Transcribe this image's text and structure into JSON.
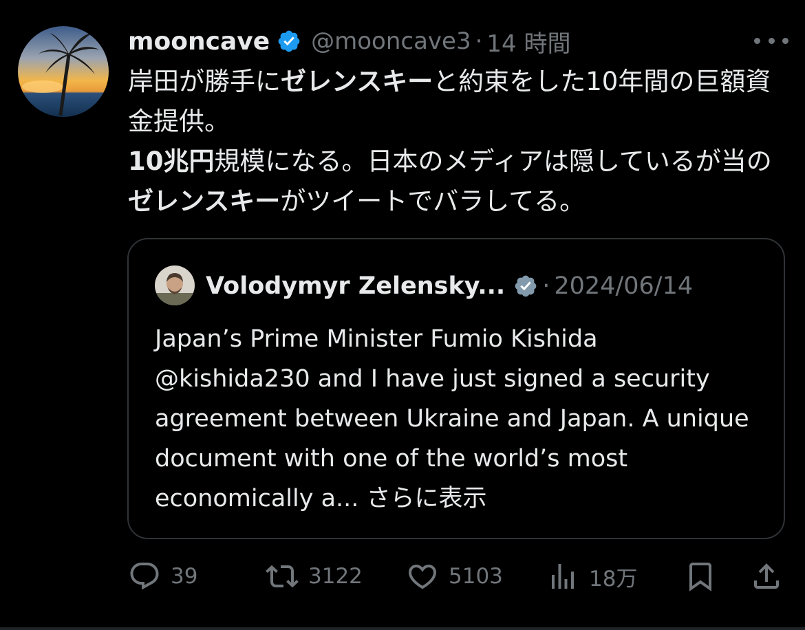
{
  "tweet": {
    "author_name": "mooncave",
    "handle": "@mooncave3",
    "separator": "·",
    "time": "14 時間",
    "text_parts": [
      {
        "text": "岸田が勝手に",
        "bold": false
      },
      {
        "text": "ゼレンスキー",
        "bold": true
      },
      {
        "text": "と約束をした10年間の巨額資金提供。",
        "bold": false
      },
      {
        "text": "10兆円",
        "bold": true
      },
      {
        "text": "規模になる。日本のメディアは隠しているが当の",
        "bold": false
      },
      {
        "text": "ゼレンスキー",
        "bold": true
      },
      {
        "text": "がツイートでバラしてる。",
        "bold": false
      }
    ]
  },
  "quote": {
    "author_name": "Volodymyr Zelensky...",
    "separator": "·",
    "date": "2024/06/14",
    "text": "Japan’s Prime Minister Fumio Kishida @kishida230 and I have just signed a security agreement between Ukraine and Japan. A unique document with one of the world’s most economically a...",
    "show_more": "さらに表示"
  },
  "actions": {
    "replies": "39",
    "retweets": "3122",
    "likes": "5103",
    "views": "18万"
  },
  "colors": {
    "background": "#000000",
    "text": "#e7e9ea",
    "secondary": "#71767b",
    "verified_blue": "#1d9bf0",
    "verified_gray": "#829aab",
    "border": "#2f3336"
  }
}
